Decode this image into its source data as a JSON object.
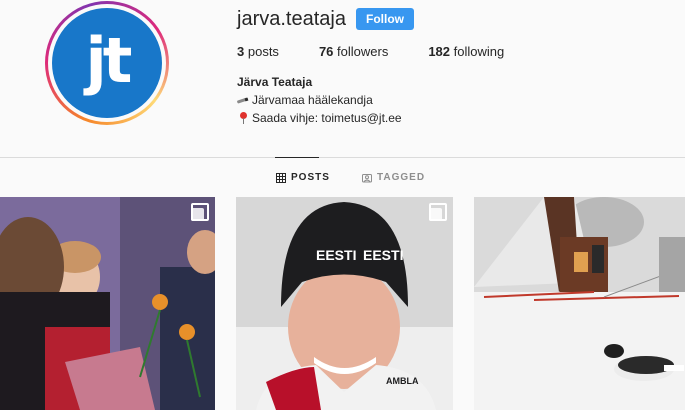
{
  "profile": {
    "username": "jarva.teataja",
    "follow_label": "Follow",
    "avatar_text": "jt",
    "full_name": "Järva Teataja",
    "bio": [
      {
        "icon": "pen-icon",
        "text": "Järvamaa häälekandja"
      },
      {
        "icon": "pin-icon",
        "text": "Saada vihje: toimetus@jt.ee"
      }
    ]
  },
  "stats": {
    "posts_count": "3",
    "posts_label": "posts",
    "followers_count": "76",
    "followers_label": "followers",
    "following_count": "182",
    "following_label": "following"
  },
  "tabs": [
    {
      "label": "POSTS",
      "icon": "grid-icon",
      "active": true
    },
    {
      "label": "TAGGED",
      "icon": "tag-icon",
      "active": false
    }
  ],
  "posts": [
    {
      "icon": "multiple-photos-icon",
      "subject": "award-ceremony"
    },
    {
      "icon": "multiple-photos-icon",
      "subject": "portrait",
      "hat_text": "EESTI EESTI",
      "jacket_text": "AMBLA"
    },
    {
      "icon": "",
      "subject": "winter-fire"
    }
  ],
  "colors": {
    "follow_button": "#3897f0",
    "avatar_bg": "#1877c9",
    "text": "#262626",
    "muted": "#8e8e8e"
  }
}
